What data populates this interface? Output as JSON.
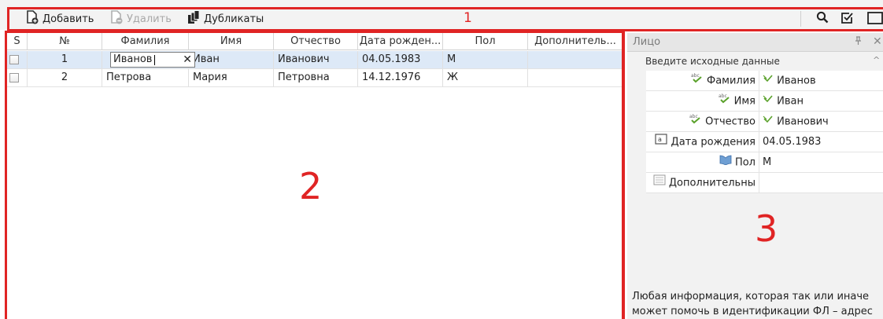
{
  "toolbar": {
    "add_label": "Добавить",
    "delete_label": "Удалить",
    "duplicates_label": "Дубликаты",
    "area_number": "1"
  },
  "grid": {
    "area_number": "2",
    "columns": [
      "S",
      "№",
      "Фамилия",
      "Имя",
      "Отчество",
      "Дата рожден...",
      "Пол",
      "Дополнитель..."
    ],
    "rows": [
      {
        "n": "1",
        "surname": "Иванов",
        "name": "Иван",
        "patronymic": "Иванович",
        "birth": "04.05.1983",
        "sex": "М",
        "extra": ""
      },
      {
        "n": "2",
        "surname": "Петрова",
        "name": "Мария",
        "patronymic": "Петровна",
        "birth": "14.12.1976",
        "sex": "Ж",
        "extra": ""
      }
    ],
    "editing_value": "Иванов"
  },
  "panel": {
    "title": "Лицо",
    "section": "Введите исходные данные",
    "area_number": "3",
    "properties": [
      {
        "label": "Фамилия",
        "value": "Иванов",
        "icon": "text-field-icon"
      },
      {
        "label": "Имя",
        "value": "Иван",
        "icon": "text-field-icon"
      },
      {
        "label": "Отчество",
        "value": "Иванович",
        "icon": "text-field-icon"
      },
      {
        "label": "Дата рождения",
        "value": "04.05.1983",
        "icon": "date-field-icon"
      },
      {
        "label": "Пол",
        "value": "М",
        "icon": "book-icon"
      },
      {
        "label": "Дополнительны",
        "value": "",
        "icon": "list-icon"
      }
    ],
    "description": "Любая информация, которая так или иначе может помочь в идентификации ФЛ – адрес проживания, сфера деятельности, места"
  },
  "colors": {
    "highlight": "#e02424",
    "selected_row": "#dde9f7",
    "accent_green": "#5aa12b"
  }
}
